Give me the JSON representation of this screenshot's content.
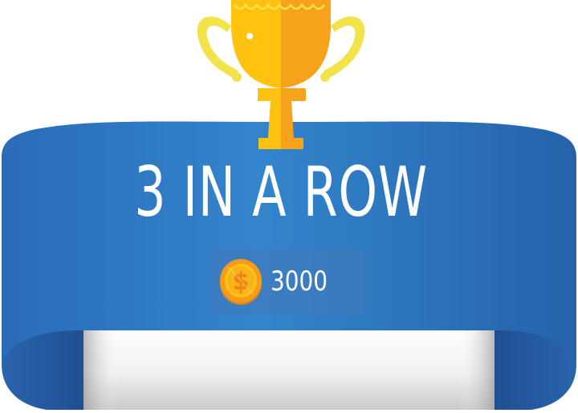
{
  "banner": {
    "title": "3 IN A ROW",
    "reward": {
      "amount": "3000",
      "icon": "dollar-coin-icon"
    }
  },
  "colors": {
    "ribbon_blue": "#2b78c4",
    "ribbon_dark": "#2460a6",
    "trophy_gold": "#ffc20e",
    "trophy_orange": "#f7a21b",
    "handle_yellow": "#f3e34a",
    "coin_orange": "#f59d1a"
  }
}
